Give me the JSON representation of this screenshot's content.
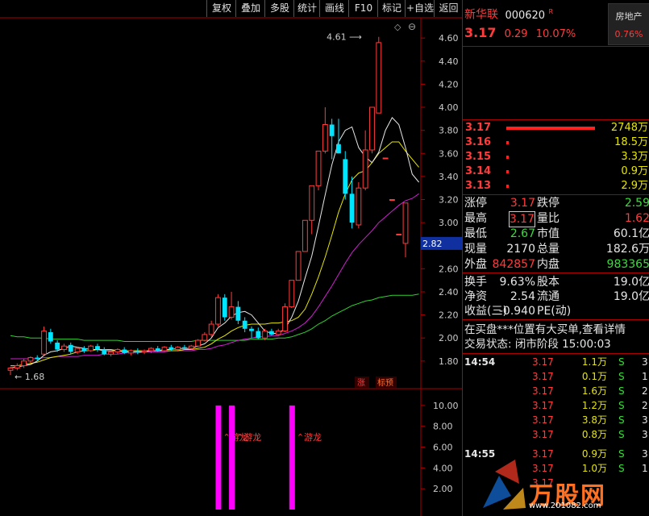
{
  "toolbar": {
    "buttons": [
      "复权",
      "叠加",
      "多股",
      "统计",
      "画线",
      "F10",
      "标记",
      "+自选",
      "返回"
    ]
  },
  "stock": {
    "name": "新华联",
    "code": "000620",
    "flag": "R",
    "sector": "房地产",
    "sector_pct": "0.76%",
    "price": "3.17",
    "change": "0.29",
    "pct": "10.07%"
  },
  "price_axis": {
    "labels": [
      "4.60",
      "4.40",
      "4.20",
      "4.00",
      "3.80",
      "3.60",
      "3.40",
      "3.20",
      "3.00",
      "2.80",
      "2.60",
      "2.40",
      "2.20",
      "2.00",
      "1.80"
    ],
    "current": "2.82"
  },
  "indicator_axis": {
    "labels": [
      "10.00",
      "8.00",
      "6.00",
      "4.00",
      "2.00"
    ]
  },
  "annotations": {
    "high": "4.61",
    "low": "1.68",
    "tag_zhang": "涨",
    "tag_biaoyu": "标预",
    "youlong1": "游龙",
    "youlong2": "游龙",
    "youlong3": "游龙"
  },
  "colors": {
    "up": "#ff3b3b",
    "down": "#00e5ff",
    "ma5": "#e8e8e8",
    "ma10": "#e6e600",
    "ma20": "#d020d0",
    "ma60": "#30d030",
    "indicator": "#ff00ff"
  },
  "chart_data": {
    "type": "candlestick",
    "ylim": [
      1.68,
      4.72
    ],
    "candles": [
      {
        "o": 1.72,
        "h": 1.75,
        "l": 1.68,
        "c": 1.74
      },
      {
        "o": 1.74,
        "h": 1.78,
        "l": 1.72,
        "c": 1.76
      },
      {
        "o": 1.76,
        "h": 1.82,
        "l": 1.74,
        "c": 1.8
      },
      {
        "o": 1.8,
        "h": 1.84,
        "l": 1.78,
        "c": 1.83
      },
      {
        "o": 1.83,
        "h": 1.85,
        "l": 1.8,
        "c": 1.82
      },
      {
        "o": 1.86,
        "h": 2.1,
        "l": 1.85,
        "c": 2.06
      },
      {
        "o": 2.05,
        "h": 2.08,
        "l": 1.95,
        "c": 1.97
      },
      {
        "o": 1.96,
        "h": 1.98,
        "l": 1.88,
        "c": 1.9
      },
      {
        "o": 1.9,
        "h": 1.95,
        "l": 1.88,
        "c": 1.93
      },
      {
        "o": 1.94,
        "h": 1.96,
        "l": 1.86,
        "c": 1.88
      },
      {
        "o": 1.88,
        "h": 1.92,
        "l": 1.86,
        "c": 1.91
      },
      {
        "o": 1.91,
        "h": 1.93,
        "l": 1.87,
        "c": 1.89
      },
      {
        "o": 1.89,
        "h": 1.94,
        "l": 1.88,
        "c": 1.93
      },
      {
        "o": 1.93,
        "h": 1.95,
        "l": 1.88,
        "c": 1.9
      },
      {
        "o": 1.9,
        "h": 1.92,
        "l": 1.85,
        "c": 1.86
      },
      {
        "o": 1.86,
        "h": 1.89,
        "l": 1.84,
        "c": 1.88
      },
      {
        "o": 1.88,
        "h": 1.91,
        "l": 1.86,
        "c": 1.9
      },
      {
        "o": 1.9,
        "h": 1.92,
        "l": 1.86,
        "c": 1.87
      },
      {
        "o": 1.87,
        "h": 1.9,
        "l": 1.85,
        "c": 1.89
      },
      {
        "o": 1.89,
        "h": 1.91,
        "l": 1.86,
        "c": 1.88
      },
      {
        "o": 1.88,
        "h": 1.9,
        "l": 1.86,
        "c": 1.89
      },
      {
        "o": 1.89,
        "h": 1.92,
        "l": 1.87,
        "c": 1.91
      },
      {
        "o": 1.91,
        "h": 1.93,
        "l": 1.88,
        "c": 1.89
      },
      {
        "o": 1.89,
        "h": 1.93,
        "l": 1.88,
        "c": 1.92
      },
      {
        "o": 1.92,
        "h": 1.94,
        "l": 1.89,
        "c": 1.9
      },
      {
        "o": 1.9,
        "h": 1.93,
        "l": 1.89,
        "c": 1.92
      },
      {
        "o": 1.92,
        "h": 1.94,
        "l": 1.9,
        "c": 1.91
      },
      {
        "o": 1.91,
        "h": 1.94,
        "l": 1.9,
        "c": 1.93
      },
      {
        "o": 1.93,
        "h": 1.99,
        "l": 1.92,
        "c": 1.98
      },
      {
        "o": 1.98,
        "h": 2.05,
        "l": 1.97,
        "c": 2.03
      },
      {
        "o": 2.03,
        "h": 2.15,
        "l": 2.01,
        "c": 2.12
      },
      {
        "o": 2.12,
        "h": 2.38,
        "l": 2.1,
        "c": 2.35
      },
      {
        "o": 2.35,
        "h": 2.38,
        "l": 2.15,
        "c": 2.18
      },
      {
        "o": 2.18,
        "h": 2.4,
        "l": 2.16,
        "c": 2.27
      },
      {
        "o": 2.27,
        "h": 2.32,
        "l": 2.12,
        "c": 2.15
      },
      {
        "o": 2.15,
        "h": 2.18,
        "l": 2.05,
        "c": 2.08
      },
      {
        "o": 2.08,
        "h": 2.1,
        "l": 2.0,
        "c": 2.06
      },
      {
        "o": 2.06,
        "h": 2.09,
        "l": 1.99,
        "c": 2.0
      },
      {
        "o": 2.0,
        "h": 2.08,
        "l": 1.98,
        "c": 2.06
      },
      {
        "o": 2.06,
        "h": 2.08,
        "l": 2.02,
        "c": 2.03
      },
      {
        "o": 2.03,
        "h": 2.08,
        "l": 2.02,
        "c": 2.06
      },
      {
        "o": 2.06,
        "h": 2.3,
        "l": 2.05,
        "c": 2.27
      },
      {
        "o": 2.27,
        "h": 2.5,
        "l": 2.26,
        "c": 2.5
      },
      {
        "o": 2.5,
        "h": 2.75,
        "l": 2.5,
        "c": 2.75
      },
      {
        "o": 2.75,
        "h": 3.02,
        "l": 2.75,
        "c": 3.02
      },
      {
        "o": 3.02,
        "h": 3.32,
        "l": 2.9,
        "c": 3.32
      },
      {
        "o": 3.32,
        "h": 3.62,
        "l": 3.28,
        "c": 3.62
      },
      {
        "o": 3.62,
        "h": 4.0,
        "l": 3.6,
        "c": 3.85
      },
      {
        "o": 3.85,
        "h": 3.9,
        "l": 3.55,
        "c": 3.75
      },
      {
        "o": 3.68,
        "h": 3.9,
        "l": 3.6,
        "c": 3.6
      },
      {
        "o": 3.55,
        "h": 3.62,
        "l": 3.2,
        "c": 3.25
      },
      {
        "o": 3.25,
        "h": 3.4,
        "l": 2.95,
        "c": 3.0
      },
      {
        "o": 2.98,
        "h": 3.35,
        "l": 2.95,
        "c": 3.3
      },
      {
        "o": 3.3,
        "h": 3.8,
        "l": 3.28,
        "c": 3.63
      },
      {
        "o": 3.63,
        "h": 4.0,
        "l": 3.6,
        "c": 4.0
      },
      {
        "o": 3.95,
        "h": 4.61,
        "l": 3.95,
        "c": 4.56
      },
      {
        "o": 3.56,
        "h": 3.56,
        "l": 3.56,
        "c": 3.56
      },
      {
        "o": 3.2,
        "h": 3.2,
        "l": 3.2,
        "c": 3.2
      },
      {
        "o": 2.9,
        "h": 2.9,
        "l": 2.9,
        "c": 2.9
      },
      {
        "o": 2.82,
        "h": 3.17,
        "l": 2.7,
        "c": 3.17
      }
    ],
    "ma5": [
      1.74,
      1.75,
      1.76,
      1.77,
      1.8,
      1.85,
      1.88,
      1.89,
      1.91,
      1.93,
      1.92,
      1.91,
      1.9,
      1.9,
      1.89,
      1.89,
      1.89,
      1.88,
      1.88,
      1.88,
      1.88,
      1.89,
      1.89,
      1.9,
      1.9,
      1.91,
      1.91,
      1.91,
      1.93,
      1.95,
      2.0,
      2.09,
      2.13,
      2.19,
      2.22,
      2.23,
      2.2,
      2.13,
      2.06,
      2.04,
      2.04,
      2.08,
      2.18,
      2.32,
      2.52,
      2.71,
      2.97,
      3.24,
      3.5,
      3.7,
      3.8,
      3.83,
      3.65,
      3.57,
      3.52,
      3.61,
      3.8,
      3.91,
      3.85,
      3.65,
      3.42,
      3.35
    ],
    "ma10": [
      1.76,
      1.76,
      1.77,
      1.78,
      1.79,
      1.81,
      1.83,
      1.84,
      1.85,
      1.86,
      1.88,
      1.89,
      1.89,
      1.9,
      1.9,
      1.9,
      1.89,
      1.89,
      1.89,
      1.89,
      1.89,
      1.89,
      1.89,
      1.89,
      1.89,
      1.89,
      1.9,
      1.9,
      1.91,
      1.92,
      1.95,
      1.99,
      2.02,
      2.06,
      2.09,
      2.11,
      2.12,
      2.12,
      2.12,
      2.13,
      2.13,
      2.14,
      2.15,
      2.18,
      2.25,
      2.38,
      2.53,
      2.7,
      2.89,
      3.09,
      3.25,
      3.37,
      3.43,
      3.45,
      3.52,
      3.6,
      3.65,
      3.7,
      3.7,
      3.62,
      3.55,
      3.48
    ],
    "ma20": [
      1.82,
      1.82,
      1.82,
      1.82,
      1.82,
      1.83,
      1.83,
      1.84,
      1.84,
      1.84,
      1.84,
      1.85,
      1.85,
      1.85,
      1.86,
      1.86,
      1.86,
      1.87,
      1.87,
      1.87,
      1.88,
      1.88,
      1.88,
      1.88,
      1.89,
      1.89,
      1.89,
      1.89,
      1.9,
      1.9,
      1.91,
      1.93,
      1.94,
      1.96,
      1.98,
      1.99,
      2.0,
      2.01,
      2.01,
      2.02,
      2.02,
      2.04,
      2.06,
      2.09,
      2.13,
      2.19,
      2.27,
      2.36,
      2.45,
      2.55,
      2.65,
      2.74,
      2.81,
      2.87,
      2.93,
      3.0,
      3.05,
      3.1,
      3.15,
      3.19,
      3.21,
      3.25
    ],
    "ma60": [
      2.02,
      2.01,
      2.01,
      2.0,
      2.0,
      2.0,
      1.99,
      1.99,
      1.99,
      1.99,
      1.99,
      1.98,
      1.98,
      1.98,
      1.98,
      1.98,
      1.98,
      1.97,
      1.97,
      1.97,
      1.97,
      1.97,
      1.97,
      1.97,
      1.97,
      1.97,
      1.97,
      1.97,
      1.98,
      1.98,
      1.98,
      1.98,
      1.98,
      1.98,
      1.98,
      1.98,
      1.99,
      1.99,
      1.99,
      1.99,
      2.0,
      2.0,
      2.01,
      2.03,
      2.05,
      2.08,
      2.12,
      2.15,
      2.19,
      2.22,
      2.25,
      2.28,
      2.3,
      2.32,
      2.33,
      2.35,
      2.36,
      2.37,
      2.37,
      2.37,
      2.37,
      2.38
    ],
    "indicator": {
      "ylim": [
        0,
        11
      ],
      "bars": [
        {
          "index": 31,
          "value": 10
        },
        {
          "index": 33,
          "value": 10
        },
        {
          "index": 42,
          "value": 10
        }
      ]
    }
  },
  "order_book": [
    {
      "price": "3.17",
      "vol": "2748万",
      "bar": 110
    },
    {
      "price": "3.16",
      "vol": "18.5万",
      "bar": 3
    },
    {
      "price": "3.15",
      "vol": "3.3万",
      "bar": 3
    },
    {
      "price": "3.14",
      "vol": "0.9万",
      "bar": 3
    },
    {
      "price": "3.13",
      "vol": "2.9万",
      "bar": 3
    }
  ],
  "stats": [
    {
      "l1": "涨停",
      "v1": "3.17",
      "c1": "red",
      "l2": "跌停",
      "v2": "2.59",
      "c2": "green"
    },
    {
      "l1": "最高",
      "v1": "3.17",
      "c1": "red",
      "boxed": true,
      "l2": "量比",
      "v2": "1.62",
      "c2": "red"
    },
    {
      "l1": "最低",
      "v1": "2.67",
      "c1": "green",
      "l2": "市值",
      "v2": "60.1亿",
      "c2": "white"
    },
    {
      "l1": "现量",
      "v1": "2170",
      "c1": "white",
      "l2": "总量",
      "v2": "182.6万",
      "c2": "white"
    },
    {
      "l1": "外盘",
      "v1": "842857",
      "c1": "red",
      "l2": "内盘",
      "v2": "983365",
      "c2": "green"
    }
  ],
  "stats2": [
    {
      "l1": "换手",
      "v1": "9.63%",
      "l2": "股本",
      "v2": "19.0亿"
    },
    {
      "l1": "净资",
      "v1": "2.54",
      "l2": "流通",
      "v2": "19.0亿"
    },
    {
      "l1": "收益(三)",
      "v1": "-0.940",
      "l2": "PE(动)",
      "v2": ""
    }
  ],
  "notice": "在买盘***位置有大买单,查看详情",
  "trade_state": "交易状态: 闭市阶段 15:00:03",
  "ticks": [
    {
      "time": "14:54",
      "price": "3.17",
      "vol": "1.1万",
      "side": "S",
      "n": "3"
    },
    {
      "time": "",
      "price": "3.17",
      "vol": "0.1万",
      "side": "S",
      "n": "1"
    },
    {
      "time": "",
      "price": "3.17",
      "vol": "1.6万",
      "side": "S",
      "n": "2"
    },
    {
      "time": "",
      "price": "3.17",
      "vol": "1.2万",
      "side": "S",
      "n": "2"
    },
    {
      "time": "",
      "price": "3.17",
      "vol": "3.8万",
      "side": "S",
      "n": "3"
    },
    {
      "time": "",
      "price": "3.17",
      "vol": "0.8万",
      "side": "S",
      "n": "3"
    },
    {
      "time": "14:55",
      "price": "3.17",
      "vol": "0.9万",
      "side": "S",
      "n": "3"
    },
    {
      "time": "",
      "price": "3.17",
      "vol": "1.0万",
      "side": "S",
      "n": "1"
    },
    {
      "time": "",
      "price": "3.17",
      "vol": "",
      "side": "",
      "n": ""
    }
  ],
  "watermark": {
    "text": "万股网",
    "url": "www.201082.com"
  }
}
